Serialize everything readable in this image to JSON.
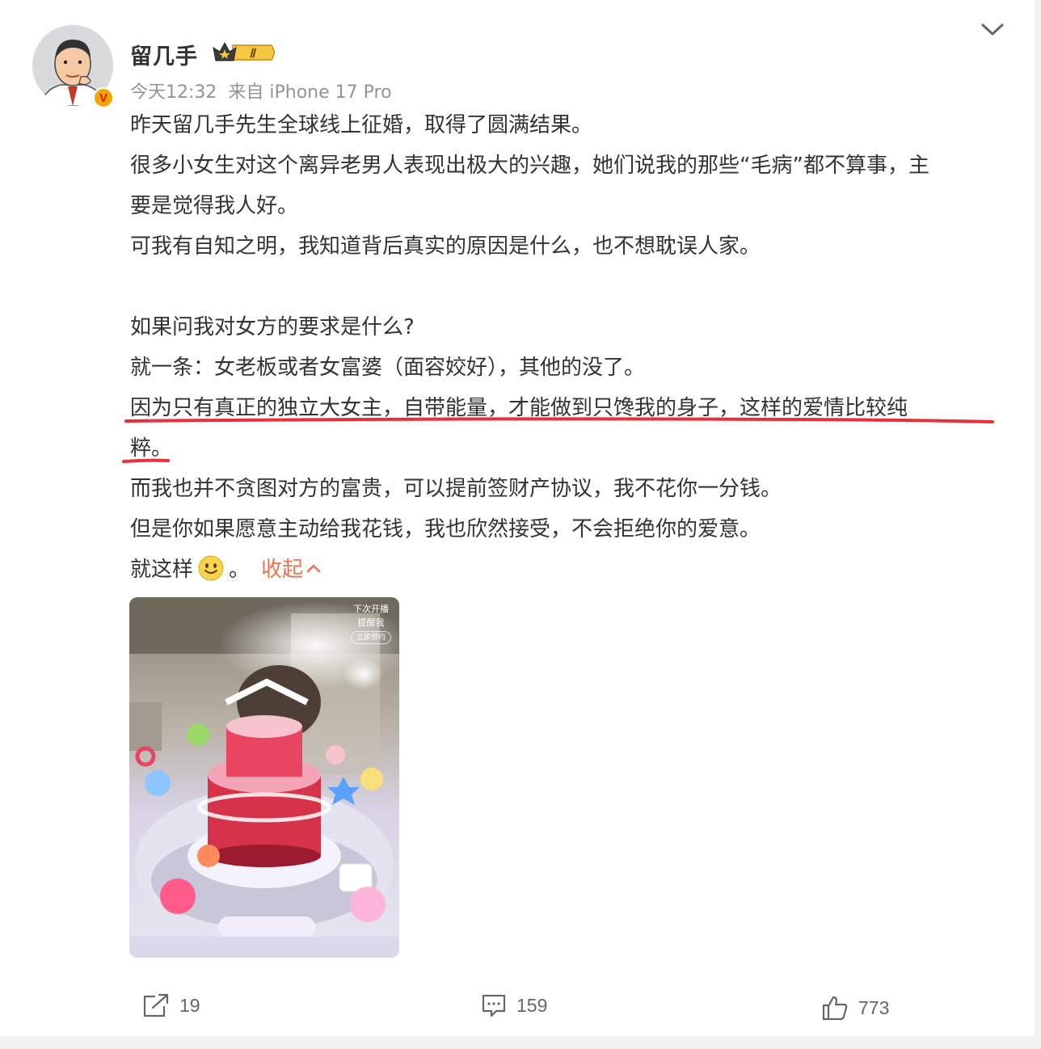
{
  "user": {
    "name": "留几手",
    "level_badge": "Ⅱ",
    "verified_mark": "V",
    "time": "今天12:32",
    "source": "来自 iPhone 17 Pro"
  },
  "post": {
    "lines": [
      "昨天留几手先生全球线上征婚，取得了圆满结果。",
      "很多小女生对这个离异老男人表现出极大的兴趣，她们说我的那些“毛病”都不算事，主",
      "要是觉得我人好。",
      "可我有自知之明，我知道背后真实的原因是什么，也不想耽误人家。",
      "",
      "如果问我对女方的要求是什么?",
      "就一条：女老板或者女富婆（面容姣好），其他的没了。",
      "因为只有真正的独立大女主，自带能量，才能做到只馋我的身子，这样的爱情比较纯",
      "粹。",
      "而我也并不贪图对方的富贵，可以提前签财产协议，我不花你一分钱。",
      "但是你如果愿意主动给我花钱，我也欣然接受，不会拒绝你的爱意。"
    ],
    "last_line_text": "就这样",
    "last_line_end": "。",
    "emoji": "smile-emoji",
    "collapse_label": "收起"
  },
  "media": {
    "overlay_line1": "下次开播",
    "overlay_line2": "提醒我",
    "overlay_button": "立即预约"
  },
  "actions": {
    "repost_count": "19",
    "comment_count": "159",
    "like_count": "773"
  },
  "colors": {
    "accent": "#eb7350",
    "underline": "#e8303a",
    "meta": "#939393",
    "text": "#333333"
  }
}
